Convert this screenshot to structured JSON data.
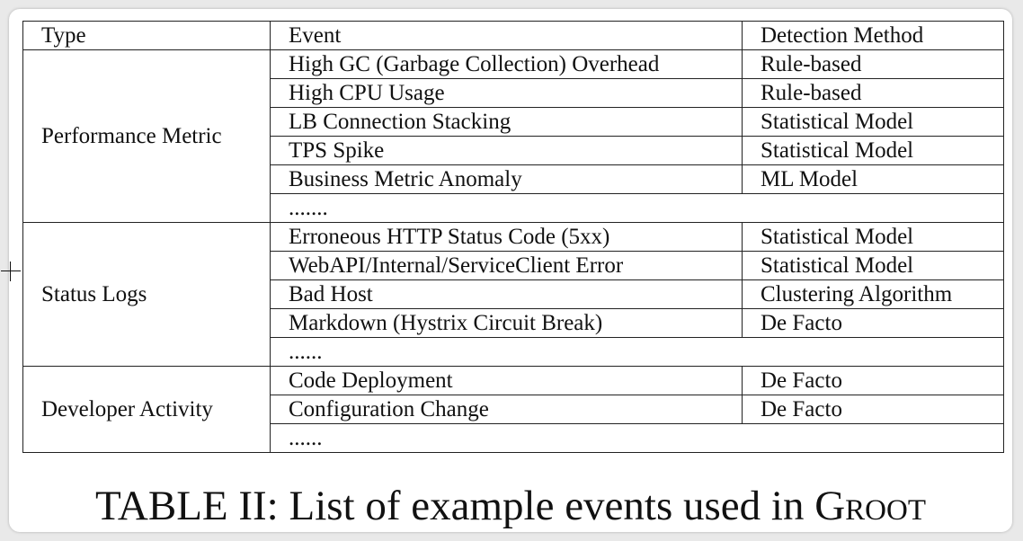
{
  "table": {
    "headers": {
      "type": "Type",
      "event": "Event",
      "method": "Detection Method"
    },
    "groups": [
      {
        "type": "Performance Metric",
        "rows": [
          {
            "event": "High GC (Garbage Collection) Overhead",
            "method": "Rule-based"
          },
          {
            "event": "High CPU Usage",
            "method": "Rule-based"
          },
          {
            "event": "LB Connection Stacking",
            "method": "Statistical Model"
          },
          {
            "event": "TPS Spike",
            "method": "Statistical Model"
          },
          {
            "event": "Business Metric Anomaly",
            "method": "ML Model"
          }
        ],
        "ellipsis": "......."
      },
      {
        "type": "Status Logs",
        "rows": [
          {
            "event": "Erroneous HTTP Status Code (5xx)",
            "method": "Statistical Model"
          },
          {
            "event": "WebAPI/Internal/ServiceClient Error",
            "method": "Statistical Model"
          },
          {
            "event": "Bad Host",
            "method": "Clustering Algorithm"
          },
          {
            "event": "Markdown (Hystrix Circuit Break)",
            "method": "De Facto"
          }
        ],
        "ellipsis": "......"
      },
      {
        "type": "Developer Activity",
        "rows": [
          {
            "event": "Code Deployment",
            "method": "De Facto"
          },
          {
            "event": "Configuration Change",
            "method": "De Facto"
          }
        ],
        "ellipsis": "......"
      }
    ]
  },
  "caption": {
    "prefix": "TABLE II: List of example events used in ",
    "name": "Groot"
  }
}
